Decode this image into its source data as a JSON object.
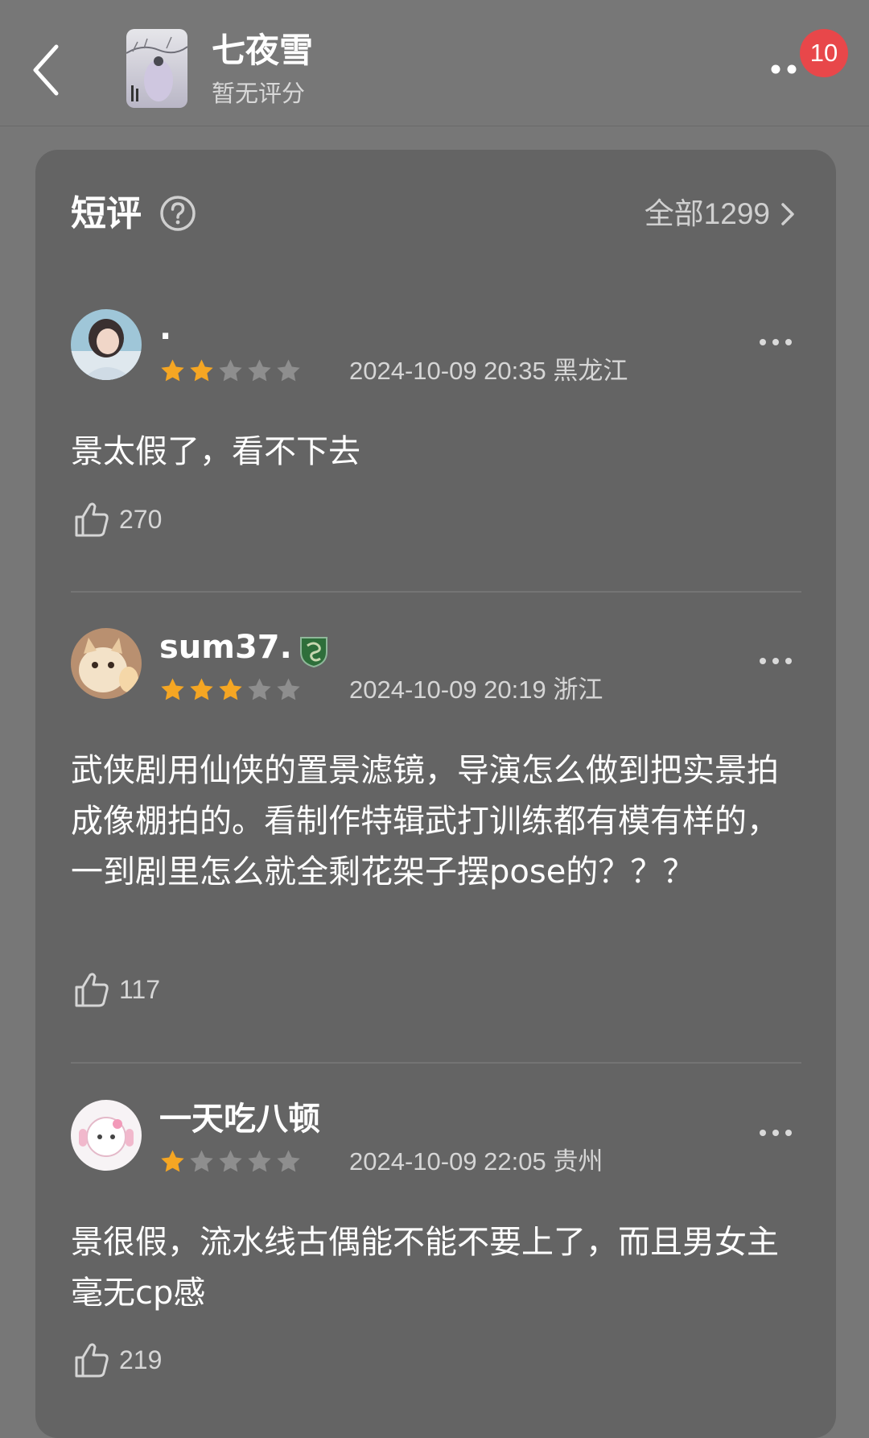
{
  "header": {
    "title": "七夜雪",
    "subtitle": "暂无评分",
    "notification_count": "10"
  },
  "section": {
    "title": "短评",
    "all_label": "全部1299"
  },
  "reviews": [
    {
      "name": ".",
      "stars": 2,
      "date": "2024-10-09 20:35 黑龙江",
      "text": "景太假了，看不下去",
      "likes": "270"
    },
    {
      "name": "sum37.",
      "stars": 3,
      "date": "2024-10-09 20:19 浙江",
      "text": "武侠剧用仙侠的置景滤镜，导演怎么做到把实景拍成像棚拍的。看制作特辑武打训练都有模有样的，一到剧里怎么就全剩花架子摆pose的？？？",
      "likes": "117"
    },
    {
      "name": "一天吃八顿",
      "stars": 1,
      "date": "2024-10-09 22:05 贵州",
      "text": "景很假，流水线古偶能不能不要上了，而且男女主毫无cp感",
      "likes": "219"
    }
  ],
  "colors": {
    "page_bg": "#777777",
    "card_bg": "#646464",
    "star_on": "#f5a623",
    "star_off": "#8e8e8e",
    "badge": "#e8474a"
  },
  "icons": [
    "back-arrow-icon",
    "more-icon",
    "help-icon",
    "chevron-right-icon",
    "star-icon",
    "thumbs-up-icon"
  ]
}
